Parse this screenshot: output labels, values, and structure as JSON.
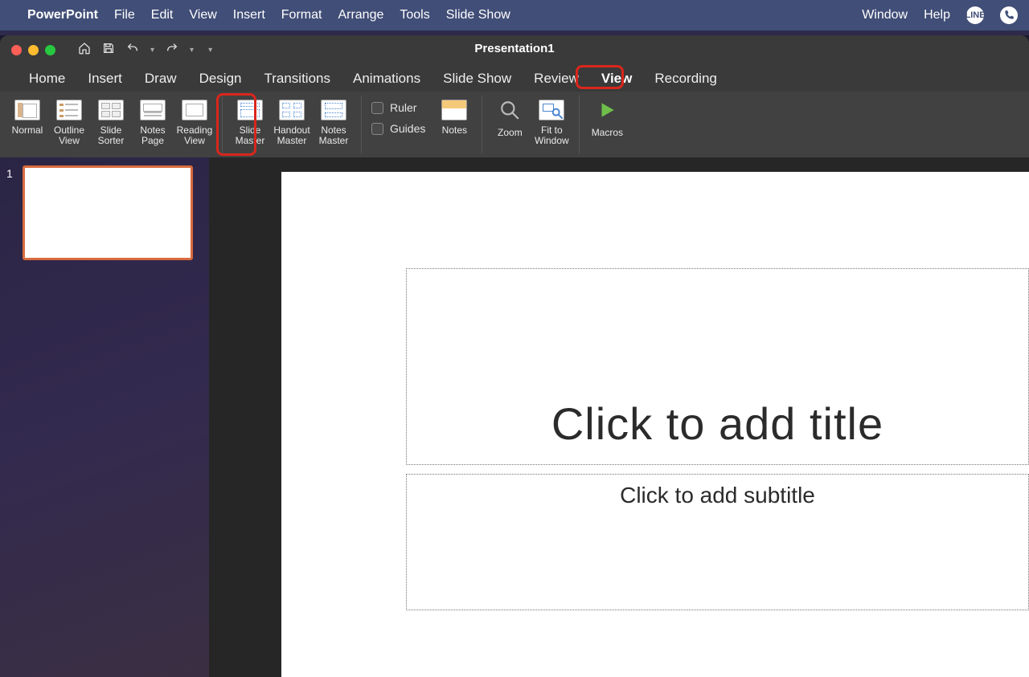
{
  "mac_menu": {
    "app": "PowerPoint",
    "items": [
      "File",
      "Edit",
      "View",
      "Insert",
      "Format",
      "Arrange",
      "Tools",
      "Slide Show"
    ],
    "right": [
      "Window",
      "Help"
    ]
  },
  "window": {
    "title": "Presentation1"
  },
  "qat": {
    "icons": [
      "home-icon",
      "save-icon",
      "undo-icon",
      "redo-icon",
      "customize-icon"
    ]
  },
  "ribbon_tabs": {
    "items": [
      "Home",
      "Insert",
      "Draw",
      "Design",
      "Transitions",
      "Animations",
      "Slide Show",
      "Review",
      "View",
      "Recording"
    ],
    "active": "View"
  },
  "ribbon": {
    "views": {
      "normal": "Normal",
      "outline": "Outline\nView",
      "sorter": "Slide\nSorter",
      "notes_page": "Notes\nPage",
      "reading": "Reading\nView"
    },
    "masters": {
      "slide_master": "Slide\nMaster",
      "handout_master": "Handout\nMaster",
      "notes_master": "Notes\nMaster"
    },
    "show": {
      "ruler": "Ruler",
      "guides": "Guides"
    },
    "notes_btn": "Notes",
    "zoom": "Zoom",
    "fit": "Fit to\nWindow",
    "macros": "Macros"
  },
  "slides_panel": {
    "items": [
      {
        "number": "1"
      }
    ]
  },
  "canvas": {
    "title_placeholder": "Click to add title",
    "subtitle_placeholder": "Click to add subtitle"
  },
  "highlights": {
    "tab": "View",
    "button": "Slide Master"
  }
}
